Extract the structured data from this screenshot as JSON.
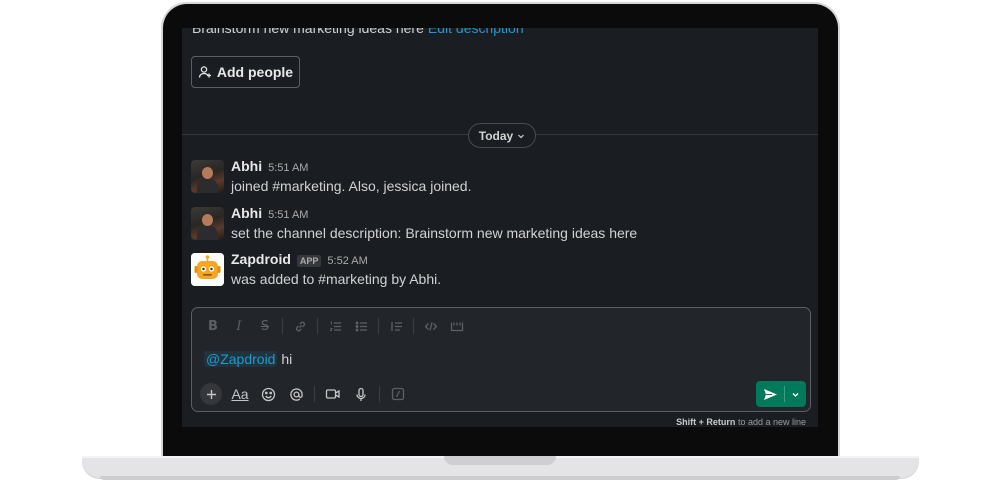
{
  "channel": {
    "description_text": "Brainstorm new marketing ideas here",
    "edit_link": "Edit description",
    "add_people_label": "Add people"
  },
  "date_divider": {
    "label": "Today"
  },
  "messages": [
    {
      "sender": "Abhi",
      "time": "5:51 AM",
      "text": "joined #marketing. Also, jessica joined.",
      "avatar": "user-photo"
    },
    {
      "sender": "Abhi",
      "time": "5:51 AM",
      "text": "set the channel description: Brainstorm new marketing ideas here",
      "avatar": "user-photo"
    },
    {
      "sender": "Zapdroid",
      "badge": "APP",
      "time": "5:52 AM",
      "text": "was added to #marketing by Abhi.",
      "avatar": "robot-icon"
    }
  ],
  "composer": {
    "mention": "@Zapdroid",
    "text": "hi",
    "formatting_tools": [
      "bold-icon",
      "italic-icon",
      "strikethrough-icon",
      "link-icon",
      "ordered-list-icon",
      "bulleted-list-icon",
      "blockquote-icon",
      "code-icon",
      "code-block-icon"
    ],
    "tools": [
      "plus-icon",
      "text-format-icon",
      "emoji-icon",
      "mention-icon",
      "video-icon",
      "microphone-icon",
      "slash-command-icon"
    ],
    "aa_label": "Aa",
    "hint_key": "Shift + Return",
    "hint_text": "to add a new line"
  },
  "colors": {
    "background": "#1a1d21",
    "link": "#1d9bd1",
    "send": "#007a5a"
  }
}
